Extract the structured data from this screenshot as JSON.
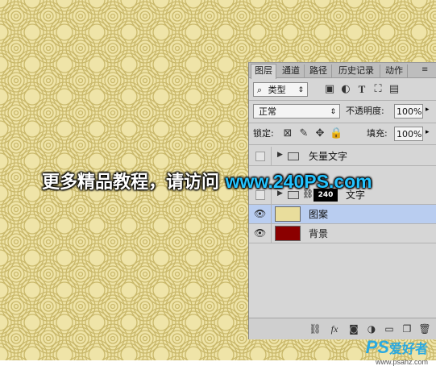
{
  "watermark": {
    "text_cn": "更多精品教程，请访问 ",
    "url": "www.240PS.com"
  },
  "tabs": [
    "图层",
    "通道",
    "路径",
    "历史记录",
    "动作"
  ],
  "filter": {
    "icon": "search-icon",
    "label": "类型",
    "arrow": "⇕"
  },
  "blend": {
    "mode": "正常",
    "opacity_label": "不透明度:",
    "opacity_value": "100%"
  },
  "lock": {
    "label": "锁定:",
    "fill_label": "填充:",
    "fill_value": "100%"
  },
  "layers": [
    {
      "name": "矢量文字",
      "type": "group",
      "visible": false
    },
    {
      "name": "文字",
      "type": "group-linked",
      "visible": false,
      "thumb_text": "240"
    },
    {
      "name": "图案",
      "type": "pixel",
      "visible": true,
      "selected": true,
      "thumb_color": "#e9dd9c"
    },
    {
      "name": "背景",
      "type": "pixel",
      "visible": true,
      "selected": false,
      "thumb_color": "#8b0000"
    }
  ],
  "logo": {
    "ps": "PS",
    "cn": "爱好者",
    "site": "www.psahz.com"
  },
  "colors": {
    "canvas": "#efe4a8",
    "watermark_url": "#23c3ff",
    "selected_layer": "#b9cdf0",
    "logo": "#2aa9e0"
  }
}
